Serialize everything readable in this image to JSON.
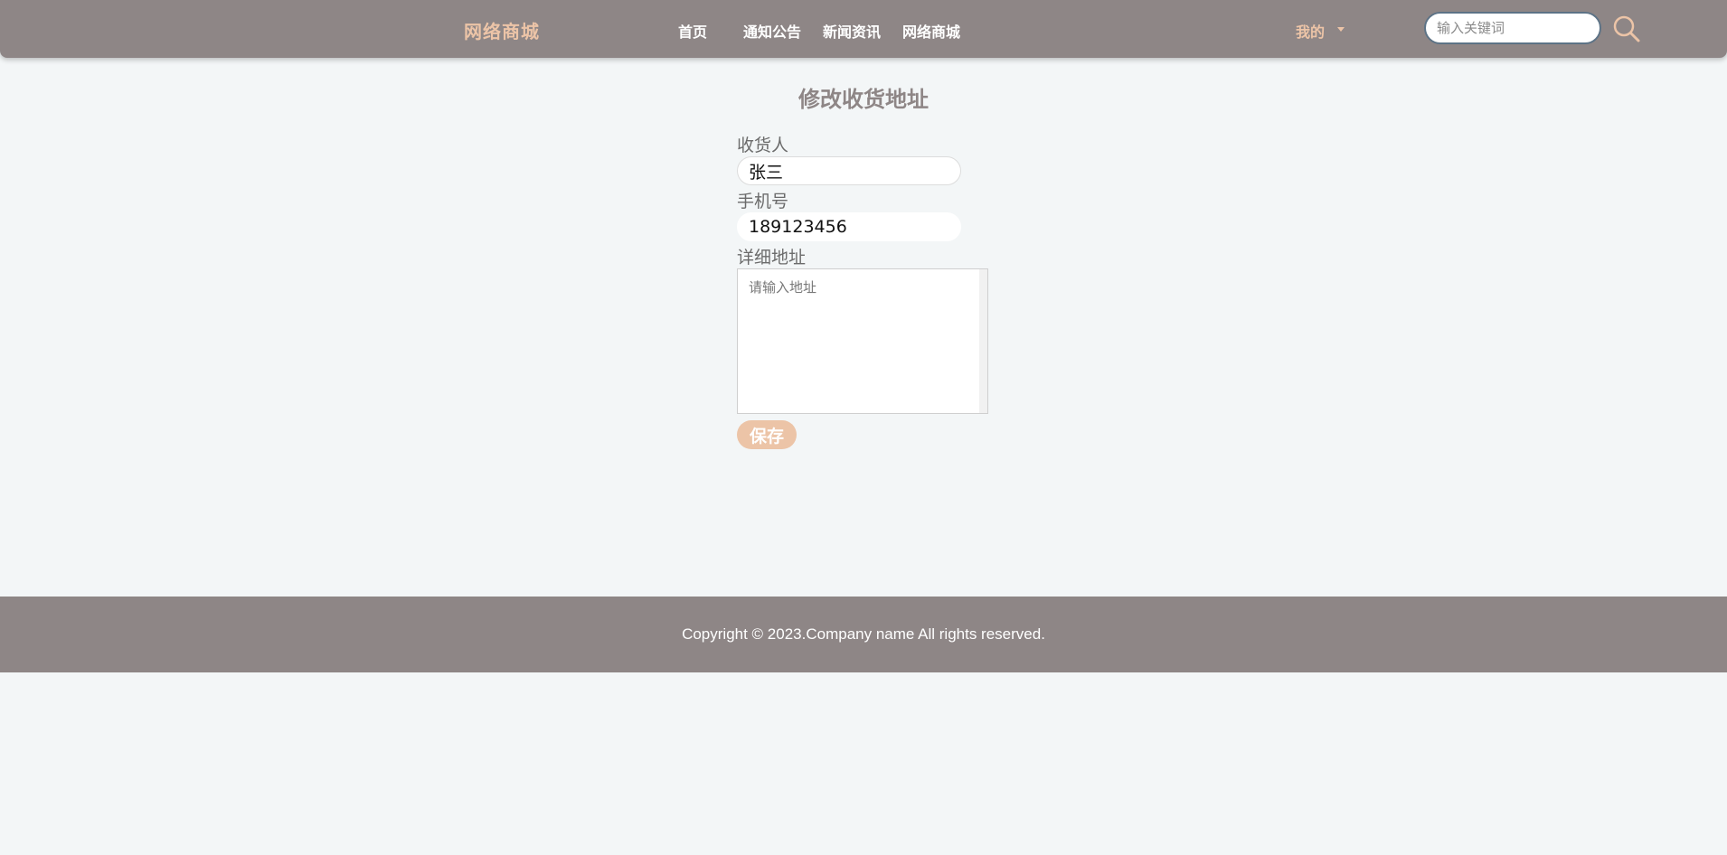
{
  "header": {
    "logo": "网络商城",
    "nav": [
      "首页",
      "通知公告",
      "新闻资讯",
      "网络商城"
    ],
    "mine_label": "我的",
    "search": {
      "placeholder": "输入关键词",
      "icon": "search-icon"
    }
  },
  "form": {
    "title": "修改收货地址",
    "receiver": {
      "label": "收货人",
      "value": "张三"
    },
    "phone": {
      "label": "手机号",
      "value": "189123456"
    },
    "address": {
      "label": "详细地址",
      "placeholder": "请输入地址",
      "value": ""
    },
    "save_label": "保存"
  },
  "footer": {
    "copyright": "Copyright © 2023.Company name All rights reserved."
  },
  "colors": {
    "header_bg": "#8e8686",
    "accent": "#ecc4a7",
    "page_bg": "#f3f6f7",
    "search_border": "#5d7386"
  }
}
